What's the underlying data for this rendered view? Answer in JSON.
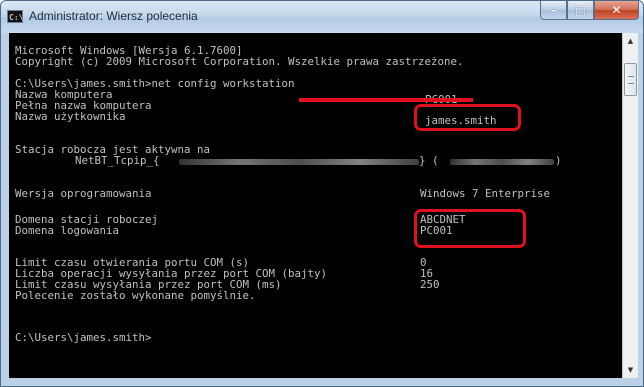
{
  "window": {
    "title": "Administrator: Wiersz polecenia",
    "icon_text": "C:\\",
    "controls": {
      "minimize": "–",
      "maximize": "□",
      "close": "✕"
    }
  },
  "console": {
    "header1": "Microsoft Windows [Wersja 6.1.7600]",
    "header2": "Copyright (c) 2009 Microsoft Corporation. Wszelkie prawa zastrzeżone.",
    "command": "C:\\Users\\james.smith>net config workstation",
    "computer_name_label": "Nazwa komputera",
    "full_name_label": "Pełna nazwa komputera",
    "full_name_value": "PC001",
    "user_name_label": "Nazwa użytkownika",
    "user_name_value": "james.smith",
    "active_on": "Stacja robocza jest aktywna na",
    "netbt_prefix": "NetBT_Tcpip_{",
    "netbt_mid": "} (",
    "netbt_end": ")",
    "version_label": "Wersja oprogramowania",
    "version_value": "Windows 7 Enterprise",
    "domain_label": "Domena stacji roboczej",
    "domain_value": "ABCDNET",
    "logon_label": "Domena logowania",
    "logon_value": "PC001",
    "com_open_label": "Limit czasu otwierania portu COM (s)",
    "com_open_value": "0",
    "com_ops_label": "Liczba operacji wysyłania przez port COM (bajty)",
    "com_ops_value": "16",
    "com_send_label": "Limit czasu wysyłania przez port COM (ms)",
    "com_send_value": "250",
    "done": "Polecenie zostało wykonane pomyślnie.",
    "prompt": "C:\\Users\\james.smith>"
  },
  "colors": {
    "highlight": "#e0101e",
    "console_bg": "#000000",
    "console_text": "#c0c0c0"
  }
}
